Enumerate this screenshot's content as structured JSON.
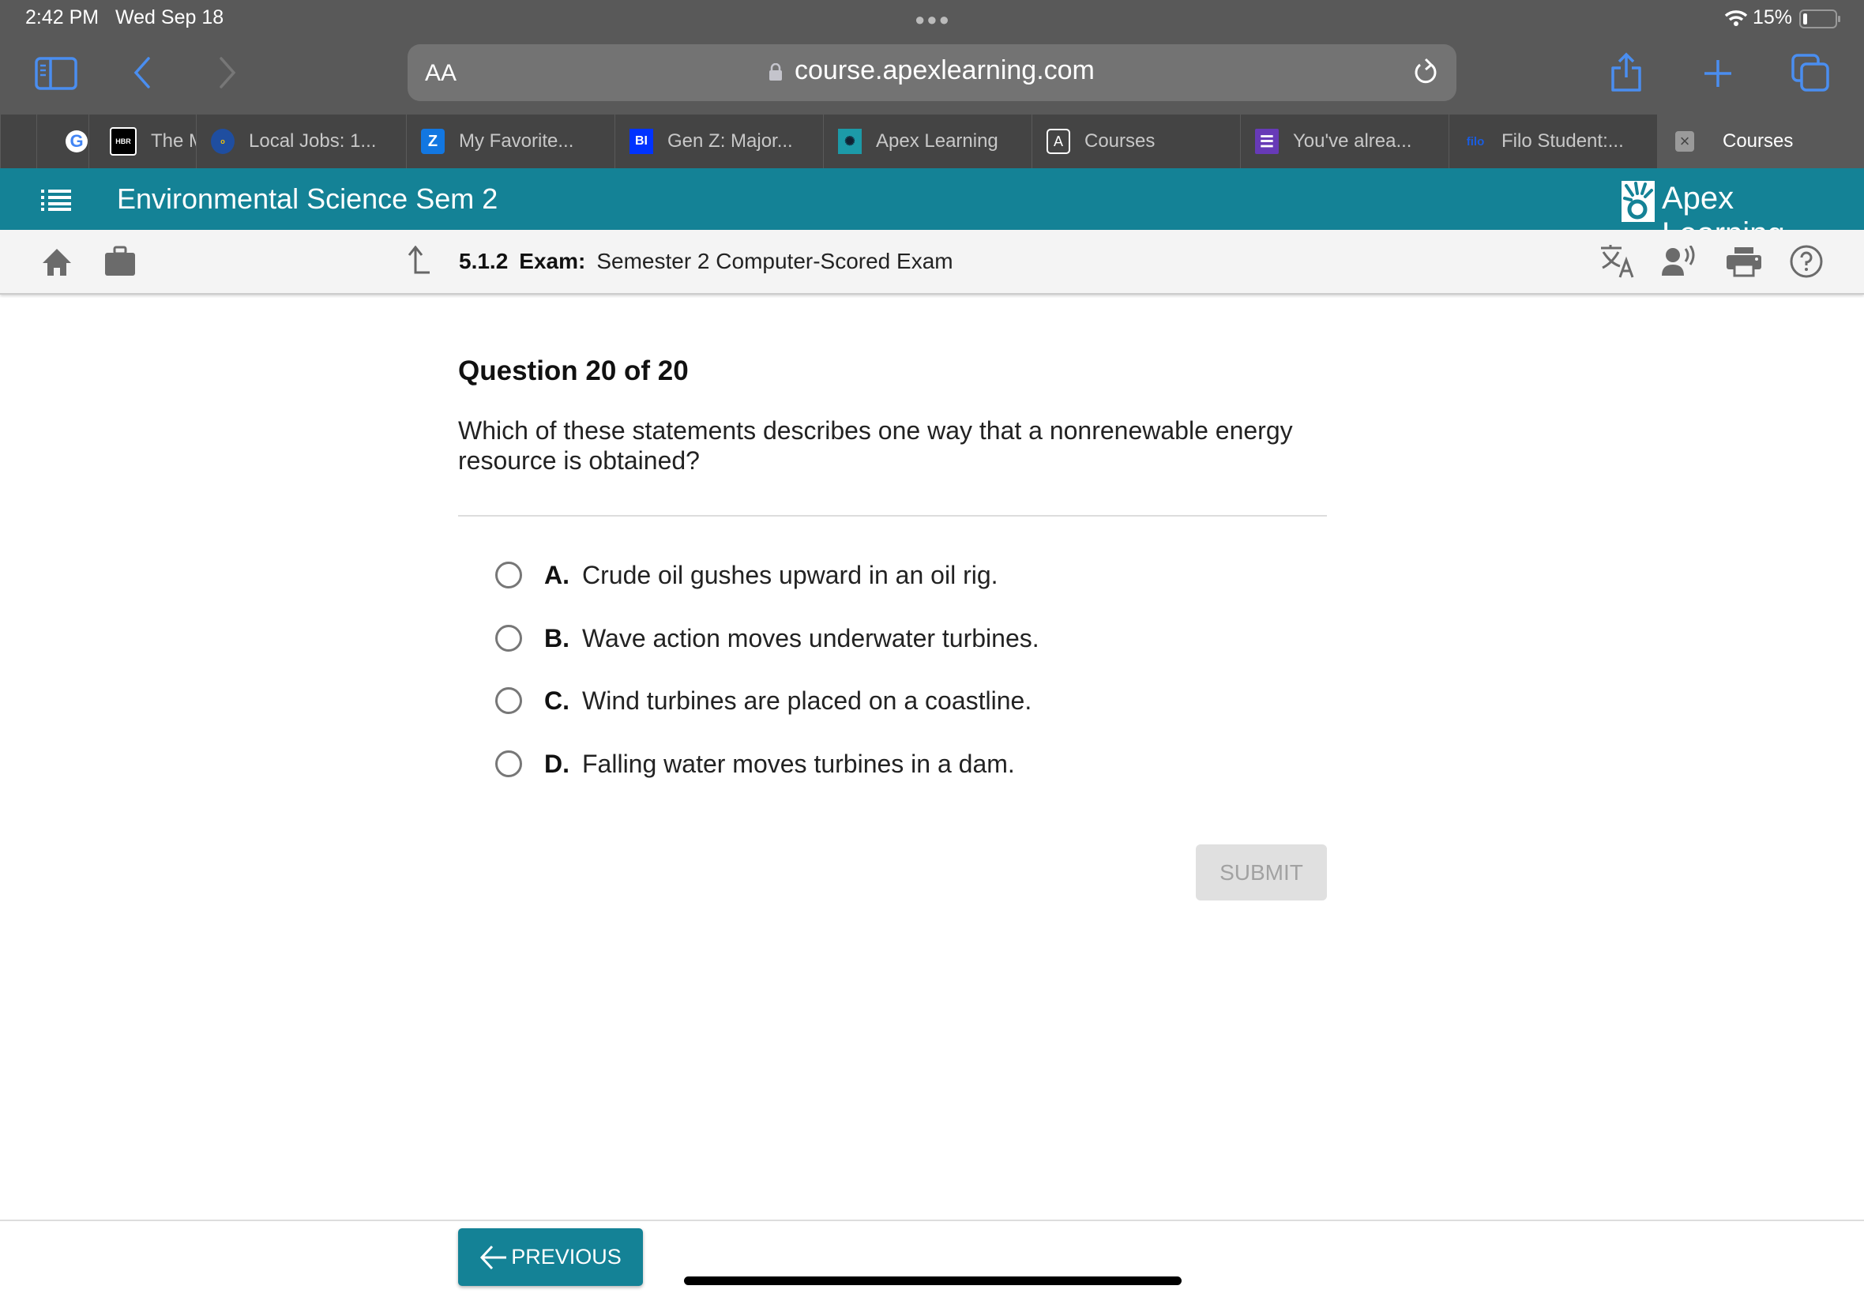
{
  "status_bar": {
    "time": "2:42 PM",
    "date": "Wed Sep 18",
    "battery": "15%"
  },
  "browser": {
    "text_size_label": "AA",
    "url": "course.apexlearning.com",
    "tabs": [
      {
        "label": "",
        "icon": "google-icon"
      },
      {
        "label": "The M",
        "icon": "hbr-icon"
      },
      {
        "label": "Local Jobs: 1...",
        "icon": "onet-icon"
      },
      {
        "label": "My Favorite...",
        "icon": "zillow-icon"
      },
      {
        "label": "Gen Z: Major...",
        "icon": "bi-icon",
        "icon_text": "BI"
      },
      {
        "label": "Apex Learning",
        "icon": "apex-icon"
      },
      {
        "label": "Courses",
        "icon": "a-icon",
        "icon_text": "A"
      },
      {
        "label": "You've alrea...",
        "icon": "forms-icon"
      },
      {
        "label": "Filo Student:...",
        "icon": "filo-icon",
        "icon_text": "filo"
      },
      {
        "label": "Courses",
        "icon": "close-icon",
        "icon_text": "×",
        "active": true
      }
    ]
  },
  "app": {
    "course_title": "Environmental Science Sem 2",
    "brand": "Apex Learning",
    "brand_color": "#148296"
  },
  "breadcrumb": {
    "number": "5.1.2",
    "type": "Exam:",
    "title": "Semester 2 Computer-Scored Exam"
  },
  "question": {
    "header": "Question 20 of 20",
    "text": "Which of these statements describes one way that a nonrenewable energy resource is obtained?",
    "options": [
      {
        "letter": "A.",
        "text": "Crude oil gushes upward in an oil rig."
      },
      {
        "letter": "B.",
        "text": "Wave action moves underwater turbines."
      },
      {
        "letter": "C.",
        "text": "Wind turbines are placed on a coastline."
      },
      {
        "letter": "D.",
        "text": "Falling water moves turbines in a dam."
      }
    ],
    "submit_label": "SUBMIT"
  },
  "footer": {
    "previous_label": "PREVIOUS"
  }
}
